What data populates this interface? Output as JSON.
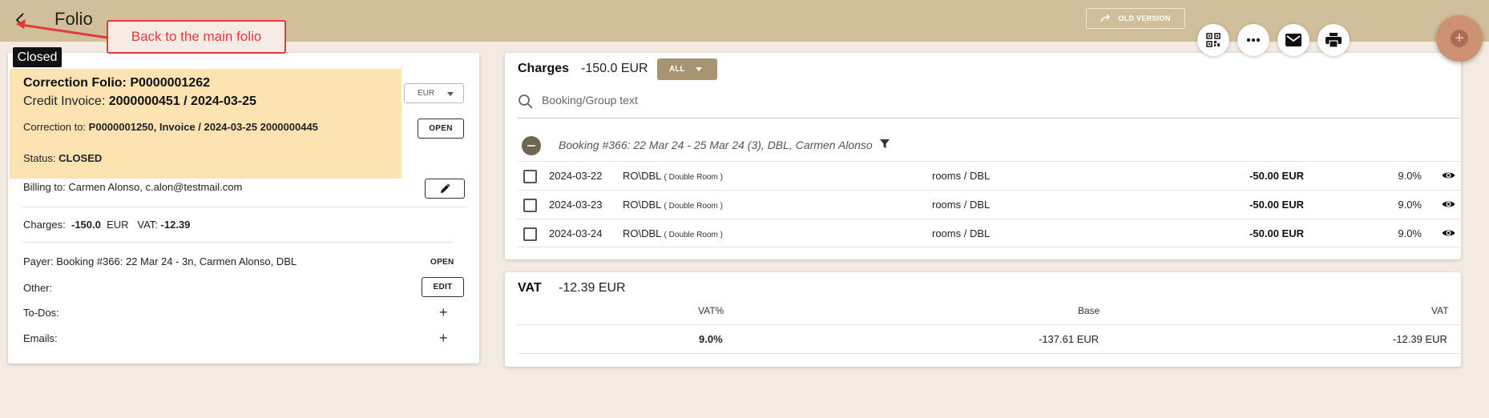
{
  "header": {
    "title": "Folio",
    "old_version_label": "OLD VERSION"
  },
  "annotation": {
    "text": "Back to the main folio"
  },
  "folio": {
    "badge": "Closed",
    "title": "Correction Folio: P0000001262",
    "invoice_label": "Credit Invoice:",
    "invoice_value": "2000000451 / 2024-03-25",
    "correction_label": "Correction to:",
    "correction_value": "P0000001250, Invoice / 2024-03-25 2000000445",
    "status_label": "Status:",
    "status_value": "CLOSED",
    "currency": "EUR",
    "open_label": "OPEN",
    "billing_label": "Billing to:",
    "billing_value": "Carmen Alonso, c.alon@testmail.com",
    "charges_label": "Charges:",
    "charges_value": "-150.0",
    "charges_currency": "EUR",
    "vat_label": "VAT:",
    "vat_value": "-12.39",
    "payer_label": "Payer:",
    "payer_value": "Booking #366: 22 Mar 24 - 3n, Carmen Alonso, DBL",
    "payer_open_label": "OPEN",
    "other_label": "Other:",
    "edit_label": "EDIT",
    "todos_label": "To-Dos:",
    "emails_label": "Emails:"
  },
  "charges": {
    "title": "Charges",
    "total": "-150.0 EUR",
    "filter_label": "ALL",
    "search_placeholder": "Booking/Group text",
    "group_label": "Booking #366: 22 Mar 24 - 25 Mar 24 (3), DBL, Carmen Alonso",
    "rows": [
      {
        "date": "2024-03-22",
        "code": "RO\\DBL",
        "code_detail": "( Double Room )",
        "category": "rooms / DBL",
        "amount": "-50.00 EUR",
        "vat": "9.0%"
      },
      {
        "date": "2024-03-23",
        "code": "RO\\DBL",
        "code_detail": "( Double Room )",
        "category": "rooms / DBL",
        "amount": "-50.00 EUR",
        "vat": "9.0%"
      },
      {
        "date": "2024-03-24",
        "code": "RO\\DBL",
        "code_detail": "( Double Room )",
        "category": "rooms / DBL",
        "amount": "-50.00 EUR",
        "vat": "9.0%"
      }
    ]
  },
  "vat": {
    "title": "VAT",
    "total": "-12.39 EUR",
    "headers": {
      "rate": "VAT%",
      "base": "Base",
      "vat": "VAT"
    },
    "rows": [
      {
        "rate": "9.0%",
        "base": "-137.61 EUR",
        "vat": "-12.39 EUR"
      }
    ]
  },
  "icons": {
    "back": "chevron-left-icon",
    "qr": "qr-code-icon",
    "more": "more-horizontal-icon",
    "email": "email-icon",
    "print": "print-icon",
    "add": "add-icon"
  },
  "colors": {
    "topbar": "#d1bf9b",
    "background": "#f3ebe2",
    "highlight": "#fde3b2",
    "accent_button": "#a89472",
    "annotation": "#e23a3a",
    "fab": "#cc9273"
  }
}
